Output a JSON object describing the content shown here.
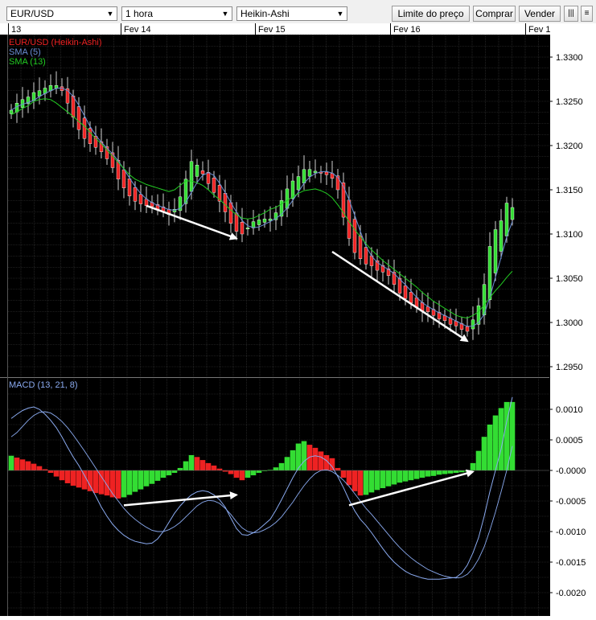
{
  "toolbar": {
    "symbol": "EUR/USD",
    "timeframe": "1 hora",
    "chart_style": "Heikin-Ashi",
    "limit_button": "Limite do preço",
    "buy_button": "Comprar",
    "sell_button": "Vender"
  },
  "colors": {
    "bull": "#33dd33",
    "bear": "#ee2222",
    "sma5": "#6b8fd6",
    "sma13": "#22cc22",
    "macd_line": "#8aaaf0",
    "grid": "#3a3a3a",
    "background": "#000000"
  },
  "chart_data": [
    {
      "type": "candlestick",
      "title": "EUR/USD (Heikin-Ashi)",
      "legend": [
        {
          "name": "EUR/USD (Heikin-Ashi)",
          "color": "#ee2222"
        },
        {
          "name": "SMA (5)",
          "color": "#6b8fd6"
        },
        {
          "name": "SMA (13)",
          "color": "#22cc22"
        }
      ],
      "x_tick_labels": [
        "13",
        "Fev 14",
        "Fev 15",
        "Fev 16",
        "Fev 1"
      ],
      "y_tick_labels": [
        "1.3300",
        "1.3250",
        "1.3200",
        "1.3150",
        "1.3100",
        "1.3050",
        "1.3000",
        "1.2950"
      ],
      "ylim": [
        1.2935,
        1.3345
      ],
      "grid": true,
      "bars": 90,
      "closes": [
        1.324,
        1.3248,
        1.3252,
        1.3255,
        1.326,
        1.3262,
        1.3265,
        1.3268,
        1.3268,
        1.3262,
        1.3248,
        1.3232,
        1.3218,
        1.3208,
        1.3202,
        1.3198,
        1.3193,
        1.3185,
        1.3175,
        1.3162,
        1.3152,
        1.3143,
        1.3137,
        1.3134,
        1.3132,
        1.3131,
        1.3128,
        1.3125,
        1.3122,
        1.3128,
        1.3142,
        1.3162,
        1.3182,
        1.3178,
        1.3168,
        1.3157,
        1.3147,
        1.3137,
        1.3125,
        1.3112,
        1.3103,
        1.31,
        1.3107,
        1.3114,
        1.3116,
        1.3117,
        1.3117,
        1.3124,
        1.3138,
        1.3151,
        1.316,
        1.3165,
        1.3173,
        1.3173,
        1.3171,
        1.317,
        1.3167,
        1.3163,
        1.315,
        1.3119,
        1.3095,
        1.3079,
        1.3072,
        1.3066,
        1.3064,
        1.3059,
        1.3057,
        1.3053,
        1.3043,
        1.3033,
        1.3027,
        1.3022,
        1.3017,
        1.3013,
        1.3012,
        1.3008,
        1.3004,
        1.3002,
        1.2998,
        1.2996,
        1.2992,
        1.299,
        1.3003,
        1.3019,
        1.3043,
        1.3086,
        1.3105,
        1.3115,
        1.3135,
        1.313
      ],
      "sma13": [
        1.3235,
        1.3238,
        1.3242,
        1.3245,
        1.325,
        1.3252,
        1.3253,
        1.3252,
        1.3248,
        1.3243,
        1.3238,
        1.3233,
        1.3227,
        1.3222,
        1.3215,
        1.3208,
        1.3202,
        1.3195,
        1.3188,
        1.3181,
        1.3174,
        1.3167,
        1.3162,
        1.3159,
        1.3156,
        1.3154,
        1.3152,
        1.315,
        1.3148,
        1.315,
        1.3155,
        1.316,
        1.316,
        1.3158,
        1.3155,
        1.315,
        1.3144,
        1.3139,
        1.3133,
        1.3127,
        1.3122,
        1.3118,
        1.3117,
        1.3118,
        1.3121,
        1.3124,
        1.3128,
        1.313,
        1.3134,
        1.3138,
        1.3142,
        1.3146,
        1.3149,
        1.315,
        1.3151,
        1.3149,
        1.3146,
        1.3141,
        1.3133,
        1.3124,
        1.3114,
        1.3105,
        1.3097,
        1.3089,
        1.3082,
        1.3076,
        1.307,
        1.3065,
        1.306,
        1.3055,
        1.305,
        1.3045,
        1.304,
        1.3034,
        1.3029,
        1.3024,
        1.302,
        1.3016,
        1.3012,
        1.3008,
        1.3006,
        1.3005,
        1.3008,
        1.3012,
        1.302,
        1.3028,
        1.3036,
        1.3043,
        1.3051,
        1.3058
      ]
    },
    {
      "type": "bar",
      "title": "MACD (13, 21, 8)",
      "y_tick_labels": [
        "0.0010",
        "0.0005",
        "-0.0000",
        "-0.0005",
        "-0.0010",
        "-0.0015",
        "-0.0020"
      ],
      "ylim": [
        -0.00215,
        0.00115
      ],
      "grid": true,
      "histogram": [
        0.00024,
        0.00021,
        0.00018,
        0.00015,
        0.00011,
        7e-05,
        2e-05,
        -4e-05,
        -0.0001,
        -0.00016,
        -0.00021,
        -0.00025,
        -0.00028,
        -0.00031,
        -0.00034,
        -0.00037,
        -0.00039,
        -0.00041,
        -0.00044,
        -0.00046,
        -0.00044,
        -0.0004,
        -0.00035,
        -0.00031,
        -0.00026,
        -0.00022,
        -0.00017,
        -0.00012,
        -8e-05,
        -4e-05,
        4e-05,
        0.00015,
        0.00025,
        0.00022,
        0.00017,
        0.00012,
        8e-05,
        3e-05,
        -2e-05,
        -6e-05,
        -0.00012,
        -0.00016,
        -0.00012,
        -8e-05,
        -4e-05,
        -1e-05,
        1e-05,
        5e-05,
        0.00012,
        0.00022,
        0.00033,
        0.00044,
        0.00048,
        0.00042,
        0.00037,
        0.00031,
        0.00025,
        0.0002,
        4e-05,
        -0.00012,
        -0.00024,
        -0.00034,
        -0.00041,
        -0.0004,
        -0.00036,
        -0.00032,
        -0.00029,
        -0.00026,
        -0.00023,
        -0.0002,
        -0.00018,
        -0.00016,
        -0.00014,
        -0.00012,
        -0.0001,
        -9e-05,
        -7e-05,
        -6e-05,
        -5e-05,
        -4e-05,
        -3e-05,
        -2e-05,
        0.00012,
        0.00032,
        0.00055,
        0.00075,
        0.0009,
        0.00102,
        0.00112,
        0.00112
      ],
      "macd": [
        0.00085,
        0.00092,
        0.00098,
        0.00102,
        0.00104,
        0.001,
        0.00092,
        0.00082,
        0.0007,
        0.00055,
        0.00038,
        0.00022,
        8e-05,
        -8e-05,
        -0.00025,
        -0.00042,
        -0.0006,
        -0.00075,
        -0.00088,
        -0.00098,
        -0.00106,
        -0.00112,
        -0.00116,
        -0.00118,
        -0.0012,
        -0.00119,
        -0.00112,
        -0.001,
        -0.00085,
        -0.0007,
        -0.00058,
        -0.00048,
        -0.0004,
        -0.00035,
        -0.00033,
        -0.00035,
        -0.0004,
        -0.00048,
        -0.0006,
        -0.00078,
        -0.00095,
        -0.00105,
        -0.00106,
        -0.00102,
        -0.00096,
        -0.00088,
        -0.0008,
        -0.00065,
        -0.00048,
        -0.0003,
        -0.00012,
        4e-05,
        0.00015,
        0.00022,
        0.00024,
        0.00022,
        0.00016,
        6e-05,
        -0.0001,
        -0.00028,
        -0.00048,
        -0.00066,
        -0.0008,
        -0.0009,
        -0.00102,
        -0.00115,
        -0.00128,
        -0.0014,
        -0.0015,
        -0.00158,
        -0.00165,
        -0.0017,
        -0.00173,
        -0.00176,
        -0.00178,
        -0.00178,
        -0.00178,
        -0.00177,
        -0.00176,
        -0.00175,
        -0.00168,
        -0.00155,
        -0.00135,
        -0.0011,
        -0.00075,
        -0.00035,
        0.0,
        0.00035,
        0.0008,
        0.0012
      ],
      "signal": [
        0.00055,
        0.00062,
        0.00072,
        0.00082,
        0.0009,
        0.00095,
        0.00096,
        0.00094,
        0.00088,
        0.0008,
        0.0007,
        0.00058,
        0.00045,
        0.00032,
        0.00018,
        4e-05,
        -0.0001,
        -0.00024,
        -0.00038,
        -0.0005,
        -0.00062,
        -0.00072,
        -0.0008,
        -0.00087,
        -0.00093,
        -0.00098,
        -0.001,
        -0.001,
        -0.00097,
        -0.00092,
        -0.00085,
        -0.00076,
        -0.00067,
        -0.00058,
        -0.00052,
        -0.00049,
        -0.0005,
        -0.00054,
        -0.00062,
        -0.00072,
        -0.00084,
        -0.00094,
        -0.001,
        -0.00102,
        -0.00101,
        -0.00097,
        -0.00092,
        -0.00085,
        -0.00076,
        -0.00064,
        -0.00052,
        -0.00038,
        -0.00025,
        -0.00014,
        -5e-05,
        0.0,
        1e-05,
        -2e-05,
        -8e-05,
        -0.00016,
        -0.00026,
        -0.00038,
        -0.0005,
        -0.00062,
        -0.00072,
        -0.00083,
        -0.00094,
        -0.00105,
        -0.00116,
        -0.00126,
        -0.00135,
        -0.00143,
        -0.0015,
        -0.00156,
        -0.00162,
        -0.00166,
        -0.0017,
        -0.00173,
        -0.00175,
        -0.00176,
        -0.00175,
        -0.0017,
        -0.0016,
        -0.00145,
        -0.00125,
        -0.00098,
        -0.00068,
        -0.00035,
        0.0,
        0.0004
      ]
    }
  ]
}
